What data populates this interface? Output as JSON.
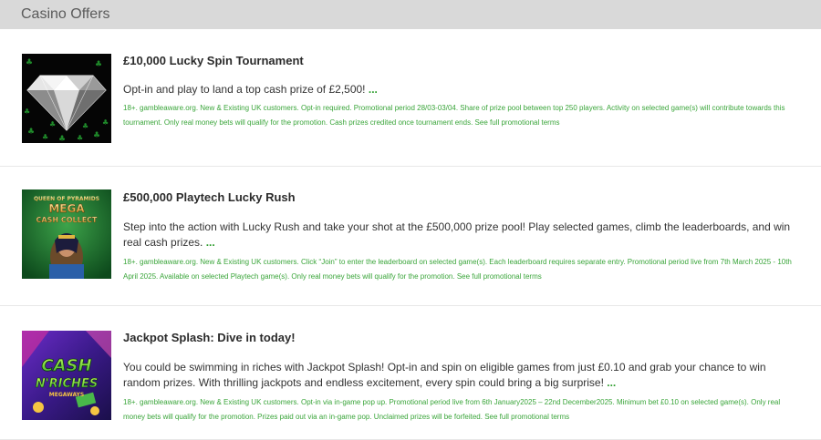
{
  "header": {
    "title": "Casino Offers"
  },
  "offers": [
    {
      "title": "£10,000 Lucky Spin Tournament",
      "description": "Opt-in and play to land a top cash prize of £2,500!",
      "more": "...",
      "terms": "18+. gambleaware.org. New & Existing UK customers. Opt-in required. Promotional period 28/03-03/04. Share of prize pool between top 250 players. Activity on selected game(s) will contribute towards this tournament. Only real money bets will qualify for the promotion. Cash prizes credited once tournament ends.",
      "terms_link": "See full promotional terms",
      "image_icon": "diamond-image"
    },
    {
      "title": "£500,000 Playtech Lucky Rush",
      "description": "Step into the action with Lucky Rush and take your shot at the £500,000 prize pool! Play selected games, climb the leaderboards, and win real cash prizes.",
      "more": "...",
      "terms": "18+. gambleaware.org. New & Existing UK customers. Click “Join” to enter the leaderboard on selected game(s). Each leaderboard requires separate entry. Promotional period live from 7th March 2025 - 10th April 2025. Available on selected Playtech game(s). Only real money bets will qualify for the promotion.",
      "terms_link": "See full promotional terms",
      "image_icon": "game-image",
      "image_text": {
        "line1": "QUEEN OF PYRAMIDS",
        "line2": "MEGA",
        "line3": "CASH COLLECT"
      }
    },
    {
      "title": "Jackpot Splash: Dive in today!",
      "description": "You could be swimming in riches with Jackpot Splash! Opt-in and spin on eligible games from just £0.10 and grab your chance to win random prizes. With thrilling jackpots and endless excitement, every spin could bring a big surprise!",
      "more": "...",
      "terms": "18+. gambleaware.org. New & Existing UK customers. Opt-in via in-game pop up. Promotional period live from 6th January2025 – 22nd December2025. Minimum bet £0.10 on selected game(s). Only real money bets will qualify for the promotion. Prizes paid out via an in-game pop. Unclaimed prizes will be forfeited.",
      "terms_link": "See full promotional terms",
      "image_icon": "game-image",
      "image_text": {
        "line1": "CASH",
        "line2": "N'RICHES",
        "line3": "MEGAWAYS"
      }
    }
  ],
  "colors": {
    "accent": "#2e9e2e",
    "terms": "#3aa53a",
    "header_bg": "#d9d9d9"
  }
}
